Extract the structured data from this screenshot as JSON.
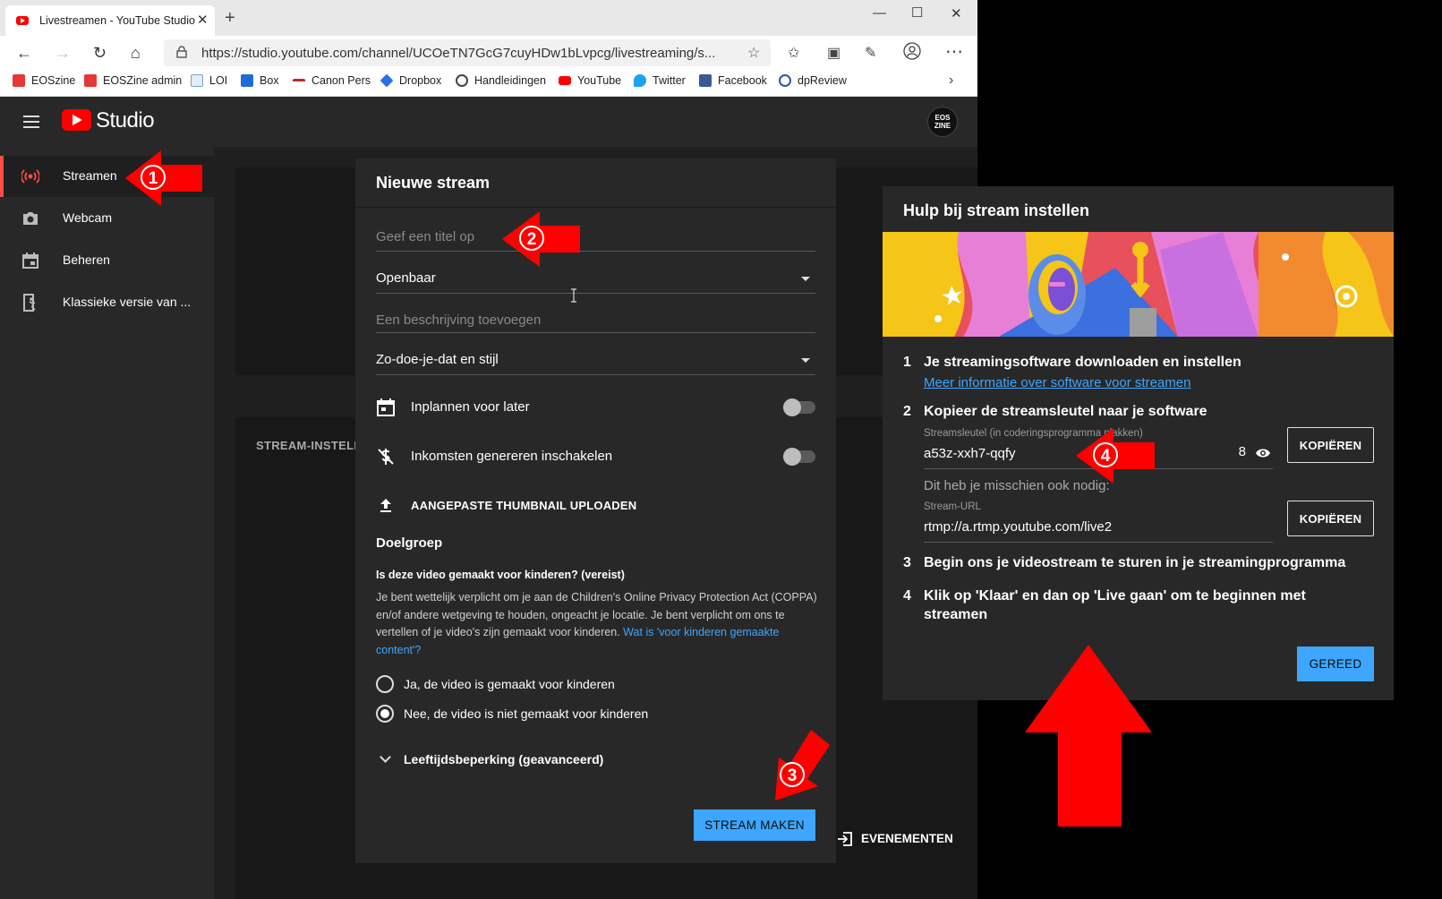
{
  "browser": {
    "tab_title": "Livestreamen - YouTube Studio",
    "new_tab": "+",
    "url": "https://studio.youtube.com/channel/UCOeTN7GcG7cuyHDw1bLvpcg/livestreaming/s...",
    "bookmarks": [
      "EOSzine",
      "EOSZine admin",
      "LOI",
      "Box",
      "Canon Pers",
      "Dropbox",
      "Handleidingen",
      "YouTube",
      "Twitter",
      "Facebook",
      "dpReview"
    ]
  },
  "studio": {
    "logo_text": "Studio",
    "avatar_text_1": "EOS",
    "avatar_text_2": "ZINE"
  },
  "sidebar": {
    "items": [
      {
        "label": "Streamen",
        "icon": "live-broadcast-icon"
      },
      {
        "label": "Webcam",
        "icon": "camera-icon"
      },
      {
        "label": "Beheren",
        "icon": "calendar-icon"
      },
      {
        "label": "Klassieke versie van ...",
        "icon": "exit-icon"
      }
    ]
  },
  "main": {
    "stream_instellingen": "STREAM-INSTELL",
    "evenementen": "EVENEMENTEN"
  },
  "dialog": {
    "title": "Nieuwe stream",
    "title_placeholder": "Geef een titel op",
    "visibility": "Openbaar",
    "description_placeholder": "Een beschrijving toevoegen",
    "category": "Zo-doe-je-dat en stijl",
    "schedule_label": "Inplannen voor later",
    "monetize_label": "Inkomsten genereren inschakelen",
    "thumbnail_label": "AANGEPASTE THUMBNAIL UPLOADEN",
    "audience_title": "Doelgroep",
    "audience_question": "Is deze video gemaakt voor kinderen? (vereist)",
    "audience_desc": "Je bent wettelijk verplicht om je aan de Children's Online Privacy Protection Act (COPPA) en/of andere wetgeving te houden, ongeacht je locatie. Je bent verplicht om ons te vertellen of je video's zijn gemaakt voor kinderen.",
    "audience_link": "Wat is 'voor kinderen gemaakte content'?",
    "radio_yes": "Ja, de video is gemaakt voor kinderen",
    "radio_no": "Nee, de video is niet gemaakt voor kinderen",
    "age_restriction": "Leeftijdsbeperking (geavanceerd)",
    "create_button": "STREAM MAKEN"
  },
  "help": {
    "title": "Hulp bij stream instellen",
    "steps": [
      {
        "num": "1",
        "text": "Je streamingsoftware downloaden en instellen"
      },
      {
        "num": "2",
        "text": "Kopieer de streamsleutel naar je software"
      },
      {
        "num": "3",
        "text": "Begin ons je videostream te sturen in je streamingprogramma"
      },
      {
        "num": "4",
        "text_line1": "Klik op 'Klaar' en dan op 'Live gaan' om te beginnen met",
        "text_line2": "streamen"
      }
    ],
    "link": "Meer informatie over software voor streamen",
    "key_label": "Streamsleutel (in coderingsprogramma plakken)",
    "key_value": "a53z-xxh7-qqfy",
    "key_count": "8",
    "copy_label": "KOPIËREN",
    "also_need": "Dit heb je misschien ook nodig:",
    "url_label": "Stream-URL",
    "url_value": "rtmp://a.rtmp.youtube.com/live2",
    "done_button": "GEREED"
  },
  "annotations": {
    "badge_1": "1",
    "badge_2": "2",
    "badge_3": "3",
    "badge_4": "4",
    "arrow_color": "#ff0000"
  }
}
